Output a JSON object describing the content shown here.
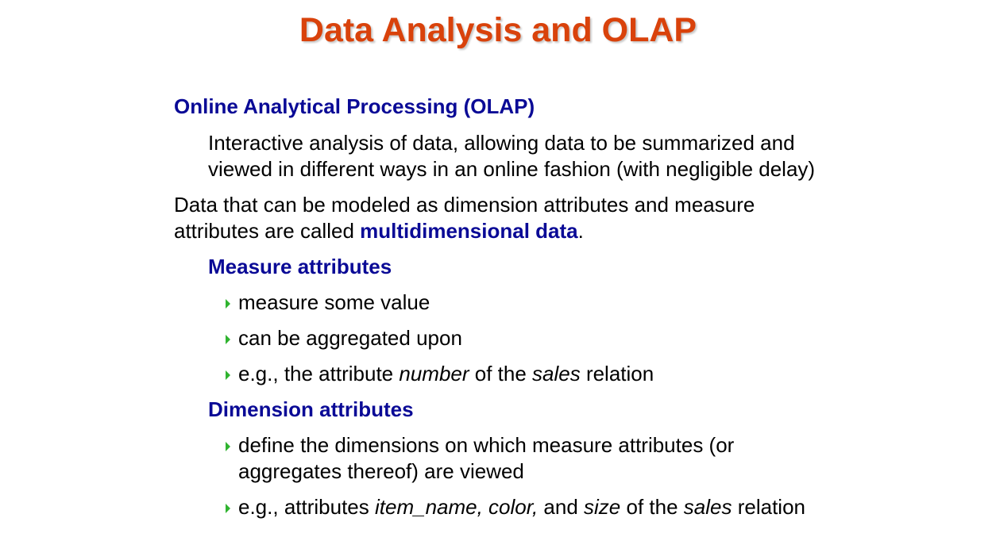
{
  "slide": {
    "title": "Data Analysis and OLAP"
  },
  "olap": {
    "heading": "Online Analytical Processing (OLAP)",
    "definition": "Interactive analysis of data, allowing data to be summarized and viewed in different ways in an online fashion (with negligible delay)"
  },
  "multidim": {
    "text_before": "Data that can be modeled as dimension attributes and measure attributes are called ",
    "term": "multidimensional data",
    "text_after": "."
  },
  "measure": {
    "heading": "Measure attributes",
    "bullet1": "measure some value",
    "bullet2": "can be aggregated upon",
    "bullet3": {
      "p1": "e.g., the attribute ",
      "p2": "number",
      "p3": " of the ",
      "p4": "sales",
      "p5": " relation"
    }
  },
  "dimension": {
    "heading": "Dimension attributes",
    "bullet1": "define the dimensions on which measure attributes (or aggregates thereof) are viewed",
    "bullet2": {
      "p1": "e.g., attributes ",
      "p2": "item_name, color,",
      "p3": " and ",
      "p4": "size",
      "p5": " of the ",
      "p6": "sales",
      "p7": " relation"
    }
  },
  "colors": {
    "title": "#d9420b",
    "heading_blue": "#0a0a96",
    "bullet_green": "#2fb32f"
  },
  "icons": {
    "bullet": "triangle-right-icon"
  }
}
